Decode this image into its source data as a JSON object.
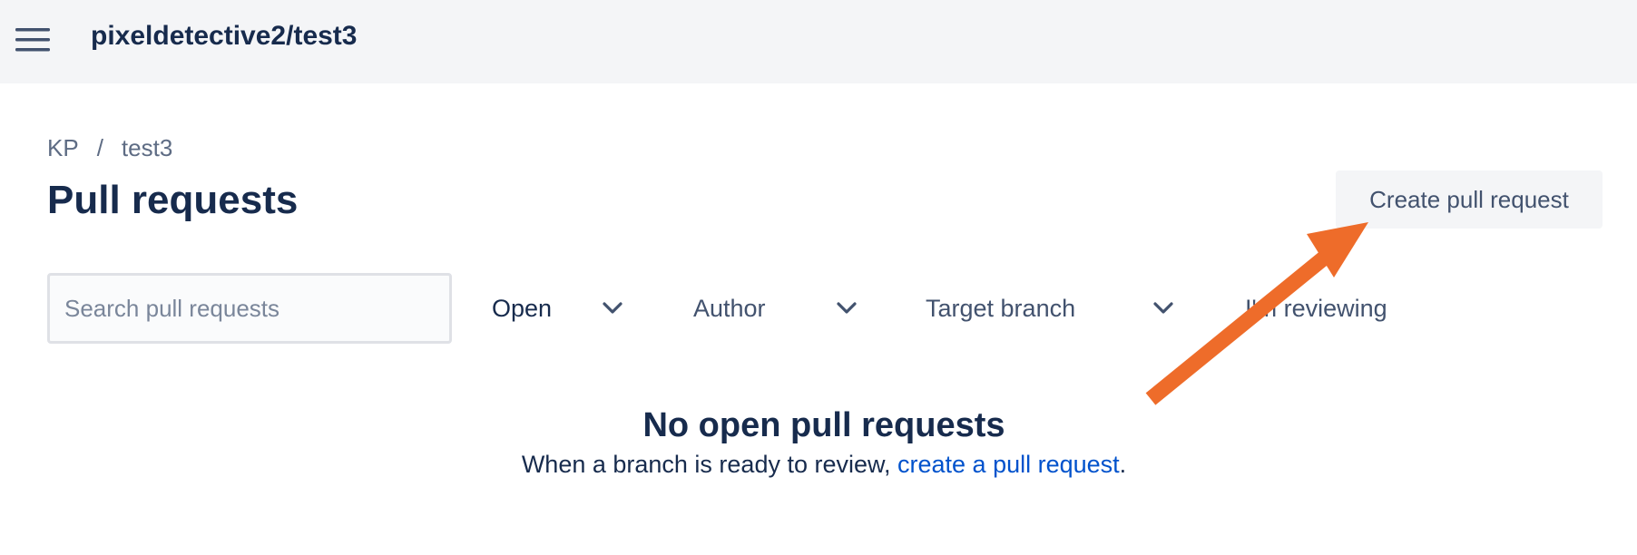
{
  "header": {
    "repo_title": "pixeldetective2/test3",
    "menu_icon": "hamburger-icon"
  },
  "breadcrumb": {
    "items": [
      "KP",
      "test3"
    ],
    "separator": "/"
  },
  "page": {
    "title": "Pull requests",
    "create_button_label": "Create pull request"
  },
  "filters": {
    "search_placeholder": "Search pull requests",
    "search_value": "",
    "state_label": "Open",
    "author_label": "Author",
    "target_branch_label": "Target branch",
    "reviewing_label": "I'm reviewing",
    "chevron_icon": "chevron-down-icon"
  },
  "empty_state": {
    "title": "No open pull requests",
    "description_prefix": "When a branch is ready to review, ",
    "link_text": "create a pull request",
    "description_suffix": "."
  },
  "annotation": {
    "arrow_color": "#ee6c2a"
  },
  "colors": {
    "topbar_bg": "#f4f5f7",
    "text_primary": "#172b4d",
    "text_secondary": "#42526e",
    "link": "#0052cc"
  }
}
